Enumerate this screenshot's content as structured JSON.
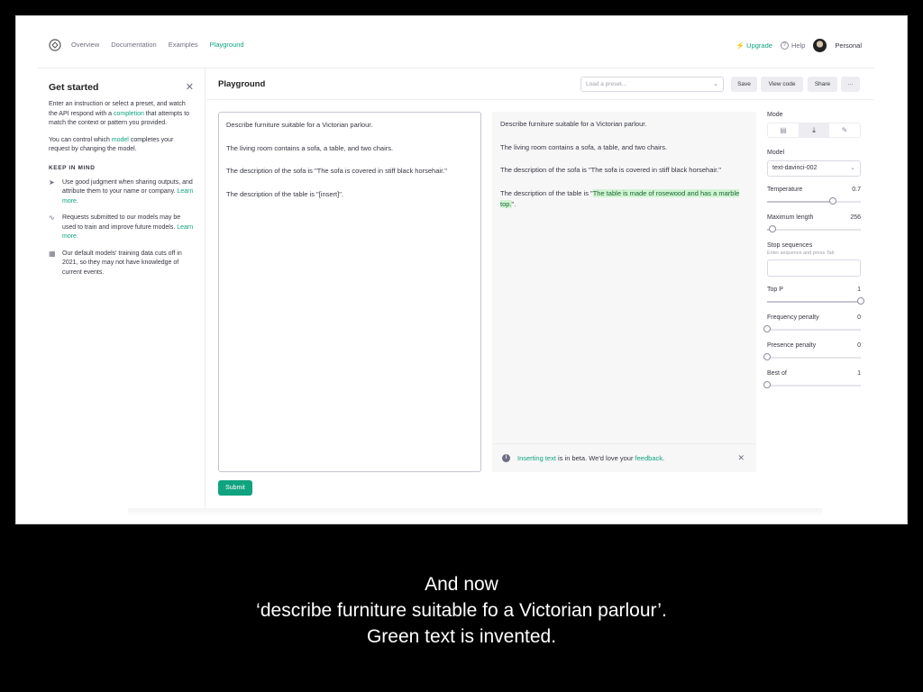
{
  "nav": {
    "links": [
      "Overview",
      "Documentation",
      "Examples",
      "Playground"
    ],
    "active": "Playground",
    "upgrade": "Upgrade",
    "help": "Help",
    "account": "Personal"
  },
  "sidebar": {
    "title": "Get started",
    "intro_a": "Enter an instruction or select a preset, and watch the API respond with a ",
    "intro_link": "completion",
    "intro_b": " that attempts to match the context or pattern you provided.",
    "control_a": "You can control which ",
    "control_link": "model",
    "control_b": " completes your request by changing the model.",
    "keep_heading": "KEEP IN MIND",
    "tips": [
      {
        "text": "Use good judgment when sharing outputs, and attribute them to your name or company. ",
        "link": "Learn more."
      },
      {
        "text": "Requests submitted to our models may be used to train and improve future models. ",
        "link": "Learn more."
      },
      {
        "text": "Our default models' training data cuts off in 2021, so they may not have knowledge of current events.",
        "link": ""
      }
    ]
  },
  "header": {
    "title": "Playground",
    "preset_placeholder": "Load a preset...",
    "save": "Save",
    "view_code": "View code",
    "share": "Share",
    "more": "···"
  },
  "editor": {
    "p1": "Describe furniture suitable for a Victorian parlour.",
    "p2": "The living room contains a sofa, a table, and two chairs.",
    "p3": "The description of the sofa is \"The sofa is covered in stiff black horsehair.\"",
    "p4": "The description of the table is \"[insert]\"."
  },
  "output": {
    "p1": "Describe furniture suitable for a Victorian parlour.",
    "p2": "The living room contains a sofa, a table, and two chairs.",
    "p3": "The description of the sofa is \"The sofa is covered in stiff black horsehair.\"",
    "p4_a": "The description of the table is \"",
    "p4_insert": "The table is made of rosewood and has a marble top.",
    "p4_b": "\".",
    "beta_link": "Inserting text",
    "beta_mid": " is in beta. We'd love your ",
    "beta_feedback": "feedback",
    "beta_end": "."
  },
  "submit": "Submit",
  "settings": {
    "mode_label": "Mode",
    "model_label": "Model",
    "model_value": "text-davinci-002",
    "temperature": {
      "label": "Temperature",
      "value": "0.7",
      "fraction": 0.7
    },
    "max_length": {
      "label": "Maximum length",
      "value": "256",
      "fraction": 0.06
    },
    "stop_label": "Stop sequences",
    "stop_hint": "Enter sequence and press Tab",
    "top_p": {
      "label": "Top P",
      "value": "1",
      "fraction": 1.0
    },
    "frequency": {
      "label": "Frequency penalty",
      "value": "0",
      "fraction": 0
    },
    "presence": {
      "label": "Presence penalty",
      "value": "0",
      "fraction": 0
    },
    "best_of": {
      "label": "Best of",
      "value": "1",
      "fraction": 0
    }
  },
  "caption": {
    "line1": "And now",
    "line2": "‘describe furniture suitable fo a Victorian parlour’.",
    "line3": "Green text is invented."
  }
}
